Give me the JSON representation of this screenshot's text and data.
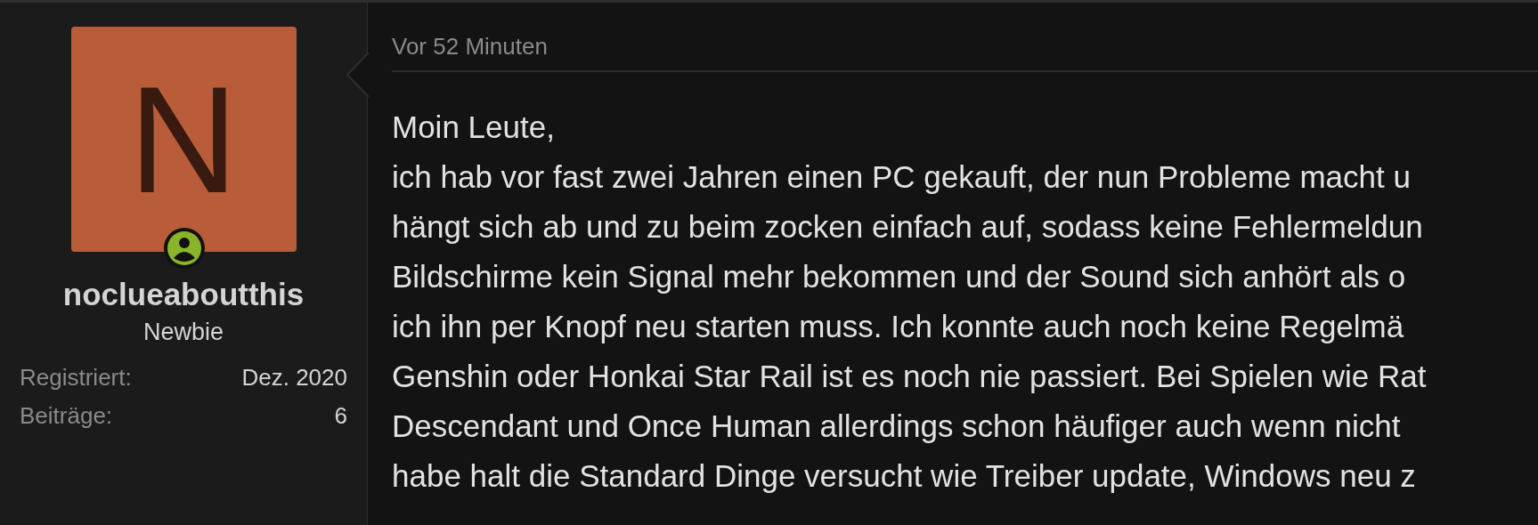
{
  "user": {
    "avatar_letter": "N",
    "online": true,
    "name": "noclueaboutthis",
    "role": "Newbie",
    "stats": [
      {
        "label": "Registriert:",
        "value": "Dez. 2020"
      },
      {
        "label": "Beiträge:",
        "value": "6"
      }
    ]
  },
  "post": {
    "time": "Vor 52 Minuten",
    "greeting": "Moin Leute,",
    "lines": [
      "ich hab vor fast zwei Jahren einen PC gekauft, der nun Probleme macht u",
      "hängt sich ab und zu beim zocken einfach auf, sodass keine Fehlermeldun",
      "Bildschirme kein Signal mehr bekommen und der Sound sich anhört als o",
      "ich ihn per Knopf neu starten muss. Ich konnte auch noch keine Regelmä",
      "Genshin oder Honkai Star Rail ist es noch nie passiert. Bei Spielen wie Rat",
      "Descendant und Once Human allerdings schon häufiger auch wenn nicht",
      "habe halt die Standard Dinge versucht wie Treiber update, Windows neu z"
    ]
  }
}
